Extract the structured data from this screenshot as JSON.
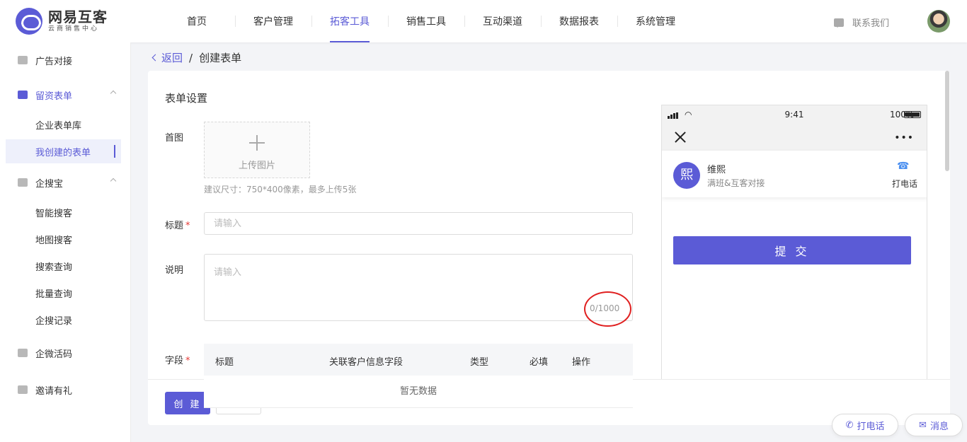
{
  "header": {
    "logo_name": "网易互客",
    "logo_sub": "云商销售中心",
    "nav": [
      "首页",
      "客户管理",
      "拓客工具",
      "销售工具",
      "互动渠道",
      "数据报表",
      "系统管理"
    ],
    "active_nav": "拓客工具",
    "contact_label": "联系我们"
  },
  "sidebar": {
    "items": [
      {
        "label": "广告对接",
        "icon": "monitor-icon"
      },
      {
        "label": "留资表单",
        "icon": "form-icon",
        "expanded": true
      },
      {
        "label": "企业表单库"
      },
      {
        "label": "我创建的表单",
        "selected": true
      },
      {
        "label": "企搜宝",
        "icon": "search-doc-icon",
        "expanded": true
      },
      {
        "label": "智能搜客"
      },
      {
        "label": "地图搜客"
      },
      {
        "label": "搜索查询"
      },
      {
        "label": "批量查询"
      },
      {
        "label": "企搜记录"
      },
      {
        "label": "企微活码",
        "icon": "qrcode-icon"
      },
      {
        "label": "邀请有礼",
        "icon": "gift-icon"
      }
    ]
  },
  "breadcrumb": {
    "back": "返回",
    "separator": "/",
    "current": "创建表单"
  },
  "form": {
    "section_title": "表单设置",
    "cover_label": "首图",
    "upload_text": "上传图片",
    "upload_hint": "建议尺寸：750*400像素，最多上传5张",
    "title_label": "标题",
    "title_placeholder": "请输入",
    "desc_label": "说明",
    "desc_placeholder": "请输入",
    "desc_counter": "0/1000",
    "fields_label": "字段",
    "required_mark": "*",
    "table_headers": [
      "标题",
      "关联客户信息字段",
      "类型",
      "必填",
      "操作"
    ],
    "table_empty": "暂无数据",
    "create_button": "创 建"
  },
  "preview": {
    "time": "9:41",
    "battery": "100%",
    "battery_level": 1.0,
    "agent_avatar_char": "熙",
    "agent_name": "维熙",
    "agent_desc": "满班&互客对接",
    "call_label": "打电话",
    "submit_button": "提 交"
  },
  "floating": {
    "call": "打电话",
    "message": "消息"
  },
  "colors": {
    "accent": "#5b5bd6",
    "required": "#e53935",
    "annotation": "#e02020"
  }
}
